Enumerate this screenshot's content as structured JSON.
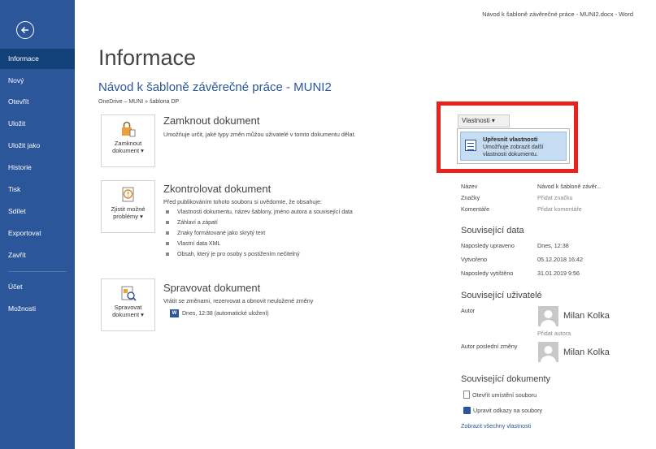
{
  "window": {
    "title": "Návod k šabloně závěrečné práce - MUNI2.docx - Word"
  },
  "sidebar": {
    "items": [
      {
        "label": "Informace"
      },
      {
        "label": "Nový"
      },
      {
        "label": "Otevřít"
      },
      {
        "label": "Uložit"
      },
      {
        "label": "Uložit jako"
      },
      {
        "label": "Historie"
      },
      {
        "label": "Tisk"
      },
      {
        "label": "Sdílet"
      },
      {
        "label": "Exportovat"
      },
      {
        "label": "Zavřít"
      },
      {
        "label": "Účet"
      },
      {
        "label": "Možnosti"
      }
    ],
    "active_label": "Informace"
  },
  "main": {
    "page_title": "Informace",
    "doc_title": "Návod k šabloně závěrečné práce - MUNI2",
    "doc_path": "OneDrive – MUNI » šablona DP",
    "protect": {
      "button_label_1": "Zamknout",
      "button_label_2": "dokument ▾",
      "heading": "Zamknout dokument",
      "description": "Umožňuje určit, jaké typy změn můžou uživatelé v tomto dokumentu dělat."
    },
    "inspect": {
      "button_label_1": "Zjistit možné",
      "button_label_2": "problémy ▾",
      "heading": "Zkontrolovat dokument",
      "description": "Před publikováním tohoto souboru si uvědomte, že obsahuje:",
      "bullets": [
        "Vlastnosti dokumentu, název šablony, jméno autora a související data",
        "Záhlaví a zápatí",
        "Znaky formátované jako skrytý text",
        "Vlastní data XML",
        "Obsah, který je pro osoby s postižením nečitelný"
      ]
    },
    "manage": {
      "button_label_1": "Spravovat",
      "button_label_2": "dokument ▾",
      "heading": "Spravovat dokument",
      "description": "Vrátit se změnami, rezervovat a obnovit neuložené změny",
      "autosave": "Dnes, 12:38 (automatické uložení)"
    }
  },
  "properties": {
    "button_label": "Vlastnosti ▾",
    "dropdown": {
      "title": "Upřesnit vlastnosti",
      "description": "Umožňuje zobrazit další vlastnosti dokumentu."
    },
    "fields": [
      {
        "label": "Název",
        "value": "Návod k šabloně závěr..."
      },
      {
        "label": "Značky",
        "value": "Přidat značku"
      },
      {
        "label": "Komentáře",
        "value": "Přidat komentáře"
      }
    ],
    "related_dates_heading": "Související data",
    "dates": [
      {
        "label": "Naposledy upraveno",
        "value": "Dnes, 12:38"
      },
      {
        "label": "Vytvořeno",
        "value": "05.12.2018 16:42"
      },
      {
        "label": "Naposledy vytištěno",
        "value": "31.01.2019 9:56"
      }
    ],
    "related_people_heading": "Související uživatelé",
    "author_label": "Autor",
    "author_name": "Milan Kolka",
    "add_author": "Přidat autora",
    "last_modified_by_label": "Autor poslední změny",
    "last_modified_by_name": "Milan Kolka",
    "related_docs_heading": "Související dokumenty",
    "open_location": "Otevřít umístění souboru",
    "edit_links": "Upravit odkazy na soubory",
    "show_all": "Zobrazit všechny vlastnosti"
  },
  "colors": {
    "sidebar": "#2b579a",
    "sidebar_active": "#124078",
    "highlight_box": "#e8231b",
    "link": "#2b579a"
  }
}
